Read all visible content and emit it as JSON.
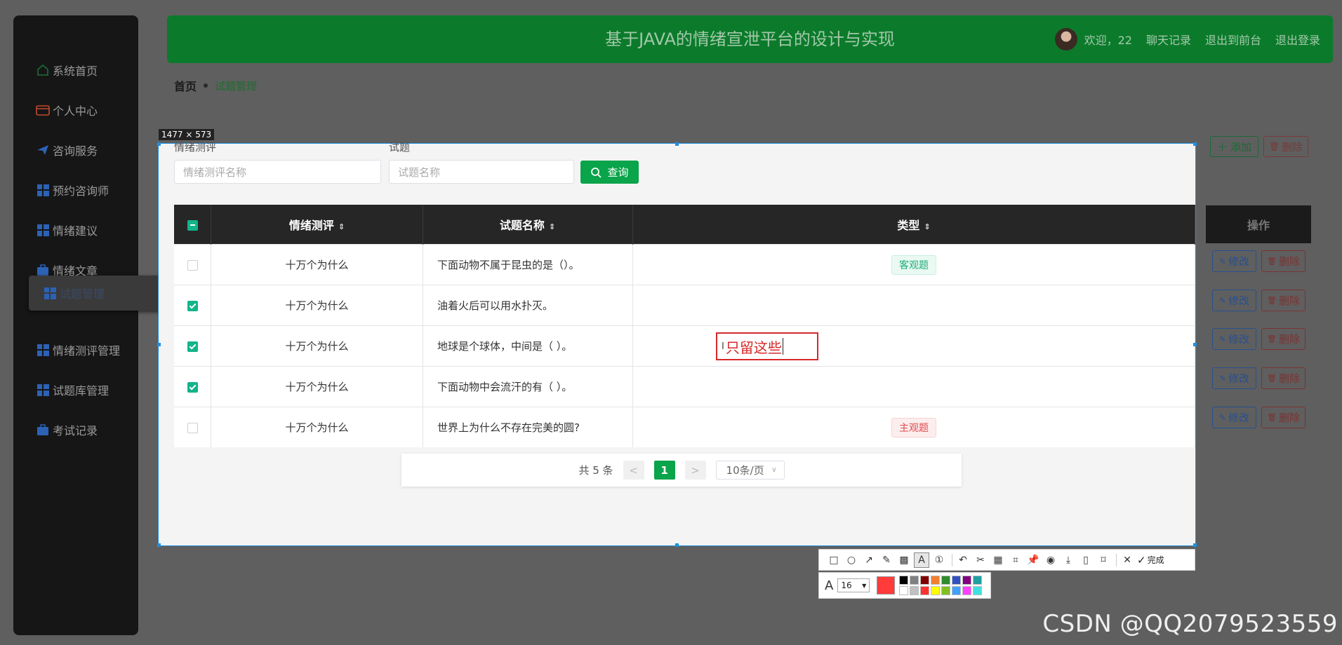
{
  "sidebar": {
    "items": [
      {
        "label": "系统首页",
        "icon": "home-icon"
      },
      {
        "label": "个人中心",
        "icon": "wallet-icon"
      },
      {
        "label": "咨询服务",
        "icon": "send-icon"
      },
      {
        "label": "预约咨询师",
        "icon": "grid-icon"
      },
      {
        "label": "情绪建议",
        "icon": "grid-icon"
      },
      {
        "label": "情绪文章",
        "icon": "briefcase-icon"
      },
      {
        "label": "试题管理",
        "icon": "grid-icon",
        "active": true
      },
      {
        "label": "情绪测评管理",
        "icon": "grid-icon"
      },
      {
        "label": "试题库管理",
        "icon": "grid-icon"
      },
      {
        "label": "考试记录",
        "icon": "briefcase-icon"
      }
    ]
  },
  "header": {
    "title": "基于JAVA的情绪宣泄平台的设计与实现",
    "welcome": "欢迎，22",
    "chat": "聊天记录",
    "front": "退出到前台",
    "logout": "退出登录"
  },
  "breadcrumb": {
    "home": "首页",
    "current": "试题管理"
  },
  "actions": {
    "add": "添加",
    "delete": "删除"
  },
  "selection": {
    "size_label": "1477 × 573"
  },
  "search": {
    "eval_label": "情绪测评",
    "eval_placeholder": "情绪测评名称",
    "question_label": "试题",
    "question_placeholder": "试题名称",
    "query_button": "查询"
  },
  "table": {
    "headers": {
      "eval": "情绪测评",
      "name": "试题名称",
      "type": "类型",
      "ops": "操作"
    },
    "rows": [
      {
        "eval": "十万个为什么",
        "name": "下面动物不属于昆虫的是（）。",
        "type": "客观题",
        "type_kind": "objective",
        "checked": false
      },
      {
        "eval": "十万个为什么",
        "name": "油着火后可以用水扑灭。",
        "type": "",
        "checked": true
      },
      {
        "eval": "十万个为什么",
        "name": "地球是个球体，中间是（ ）。",
        "type": "",
        "checked": true
      },
      {
        "eval": "十万个为什么",
        "name": "下面动物中会流汗的有（ ）。",
        "type": "",
        "checked": true
      },
      {
        "eval": "十万个为什么",
        "name": "世界上为什么不存在完美的圆?",
        "type": "主观题",
        "type_kind": "subjective",
        "checked": false
      }
    ],
    "row_edit": "修改",
    "row_delete": "删除"
  },
  "pagination": {
    "total": "共 5 条",
    "current_page": "1",
    "page_size": "10条/页"
  },
  "annotation": {
    "text": "只留这些",
    "font_size": "16",
    "done": "完成"
  },
  "colors": {
    "brand_green": "#0aa44a",
    "header_green": "#0b7b2b",
    "annotation_red": "#ff3b3b",
    "selection_blue": "#1f8fe0"
  },
  "palette": [
    "#000000",
    "#808080",
    "#800000",
    "#f08030",
    "#2e8b2e",
    "#3050c0",
    "#800080",
    "#20a0a0",
    "#ffffff",
    "#c0c0c0",
    "#ff3030",
    "#ffff00",
    "#80c020",
    "#40a0ff",
    "#ff40ff",
    "#40e0e0"
  ],
  "watermark": "CSDN @QQ2079523559"
}
